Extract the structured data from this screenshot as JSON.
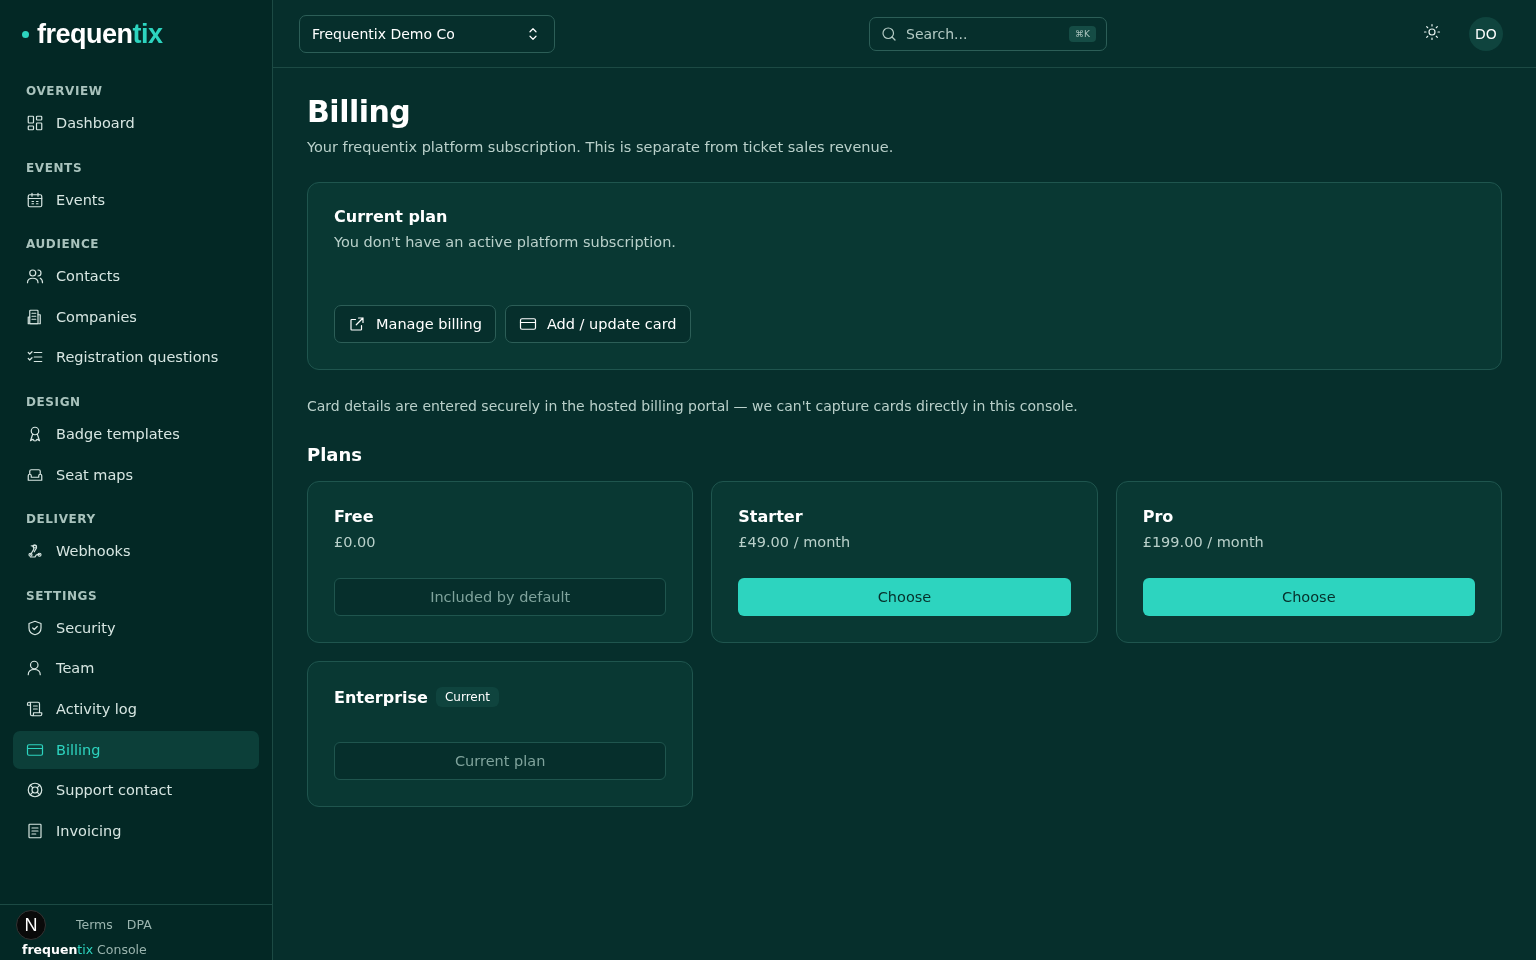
{
  "brand": {
    "name_main": "frequen",
    "name_accent": "tix"
  },
  "sidebar": {
    "sections": [
      {
        "heading": "OVERVIEW",
        "items": [
          {
            "label": "Dashboard",
            "selected": false
          }
        ]
      },
      {
        "heading": "EVENTS",
        "items": [
          {
            "label": "Events",
            "selected": false
          }
        ]
      },
      {
        "heading": "AUDIENCE",
        "items": [
          {
            "label": "Contacts",
            "selected": false
          },
          {
            "label": "Companies",
            "selected": false
          },
          {
            "label": "Registration questions",
            "selected": false
          }
        ]
      },
      {
        "heading": "DESIGN",
        "items": [
          {
            "label": "Badge templates",
            "selected": false
          },
          {
            "label": "Seat maps",
            "selected": false
          }
        ]
      },
      {
        "heading": "DELIVERY",
        "items": [
          {
            "label": "Webhooks",
            "selected": false
          }
        ]
      },
      {
        "heading": "SETTINGS",
        "items": [
          {
            "label": "Security",
            "selected": false
          },
          {
            "label": "Team",
            "selected": false
          },
          {
            "label": "Activity log",
            "selected": false
          },
          {
            "label": "Billing",
            "selected": true
          },
          {
            "label": "Support contact",
            "selected": false
          },
          {
            "label": "Invoicing",
            "selected": false
          }
        ]
      }
    ],
    "footer": {
      "links": [
        "Terms",
        "DPA"
      ],
      "dev_badge": "N",
      "product_main": "frequen",
      "product_accent": "tix",
      "product_suffix": "Console"
    }
  },
  "header": {
    "org_select": "Frequentix Demo Co",
    "search": {
      "placeholder": "Search...",
      "shortcut": "⌘K"
    },
    "avatar": "DO"
  },
  "page": {
    "title": "Billing",
    "subtitle": "Your frequentix platform subscription. This is separate from ticket sales revenue.",
    "current_plan": {
      "title": "Current plan",
      "text": "You don't have an active platform subscription.",
      "buttons": [
        "Manage billing",
        "Add / update card"
      ]
    },
    "note": "Card details are entered securely in the hosted billing portal — we can't capture cards directly in this console.",
    "plans_heading": "Plans",
    "plans": [
      {
        "name": "Free",
        "price": "£0.00",
        "action": "Included by default",
        "kind": "disabled"
      },
      {
        "name": "Starter",
        "price": "£49.00 / month",
        "action": "Choose",
        "kind": "choose"
      },
      {
        "name": "Pro",
        "price": "£199.00 / month",
        "action": "Choose",
        "kind": "choose"
      },
      {
        "name": "Enterprise",
        "badge": "Current",
        "action": "Current plan",
        "kind": "disabled"
      }
    ]
  }
}
